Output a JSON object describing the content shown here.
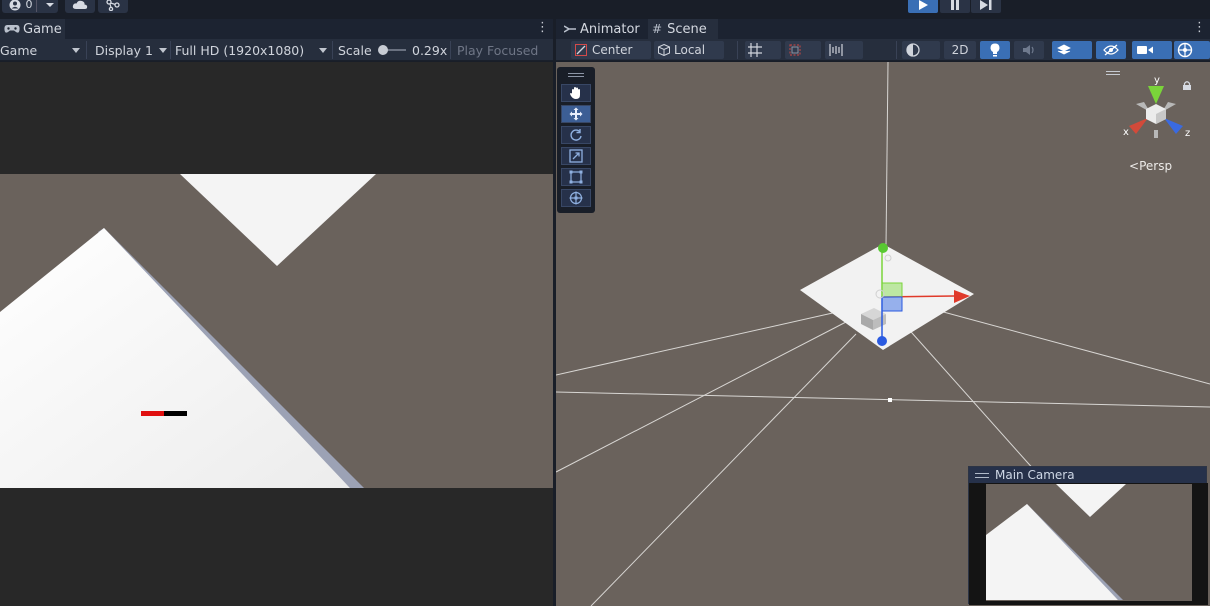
{
  "topbar": {
    "account_value": "0",
    "play_state": "playing"
  },
  "game_panel": {
    "tab_label": "Game",
    "mode_dropdown": "Game",
    "display_dropdown": "Display 1",
    "resolution_dropdown": "Full HD (1920x1080)",
    "scale_label": "Scale",
    "scale_value": "0.29x",
    "scale_fraction": 0.1,
    "play_focused_label": "Play Focused",
    "health_fraction": 0.5
  },
  "scene_panel": {
    "tabs": [
      {
        "label": "Animator",
        "glyph": "animator-icon"
      },
      {
        "label": "Scene",
        "glyph": "grid-icon"
      }
    ],
    "pivot_dropdown": "Center",
    "space_dropdown": "Local",
    "mode_2d_label": "2D",
    "gizmo_axes": {
      "x": "x",
      "y": "y",
      "z": "z"
    },
    "projection_label": "Persp",
    "tools": [
      "hand-tool",
      "move-tool",
      "rotate-tool",
      "scale-tool",
      "rect-tool",
      "transform-tool"
    ],
    "active_tool": "move-tool",
    "camera_preview_title": "Main Camera"
  },
  "colors": {
    "accent_blue": "#3a6fb5",
    "scene_background": "#6a625c",
    "health_red": "#e01010",
    "axis_x": "#e03a2a",
    "axis_y": "#7ad43a",
    "axis_z": "#2a5ae0"
  }
}
